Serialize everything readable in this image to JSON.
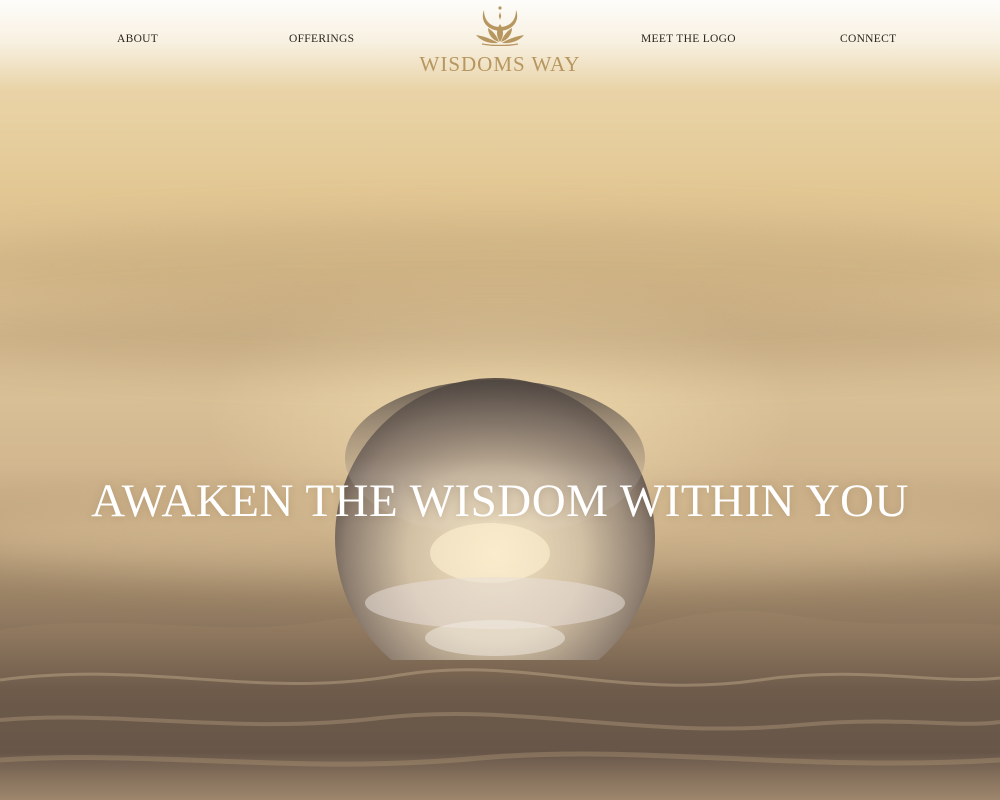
{
  "nav": {
    "items": [
      {
        "label": "ABOUT"
      },
      {
        "label": "OFFERINGS"
      },
      {
        "label": "MEET THE LOGO"
      },
      {
        "label": "CONNECT"
      }
    ]
  },
  "logo": {
    "text": "WISDOMS  WAY",
    "icon": "lotus-moon-icon"
  },
  "hero": {
    "headline": "AWAKEN THE WISDOM WITHIN YOU",
    "image": "crystal-ball-in-water-at-sunset"
  },
  "colors": {
    "logo_gold": "#b7975f",
    "nav_text": "#2a241c",
    "headline_text": "#ffffff"
  }
}
